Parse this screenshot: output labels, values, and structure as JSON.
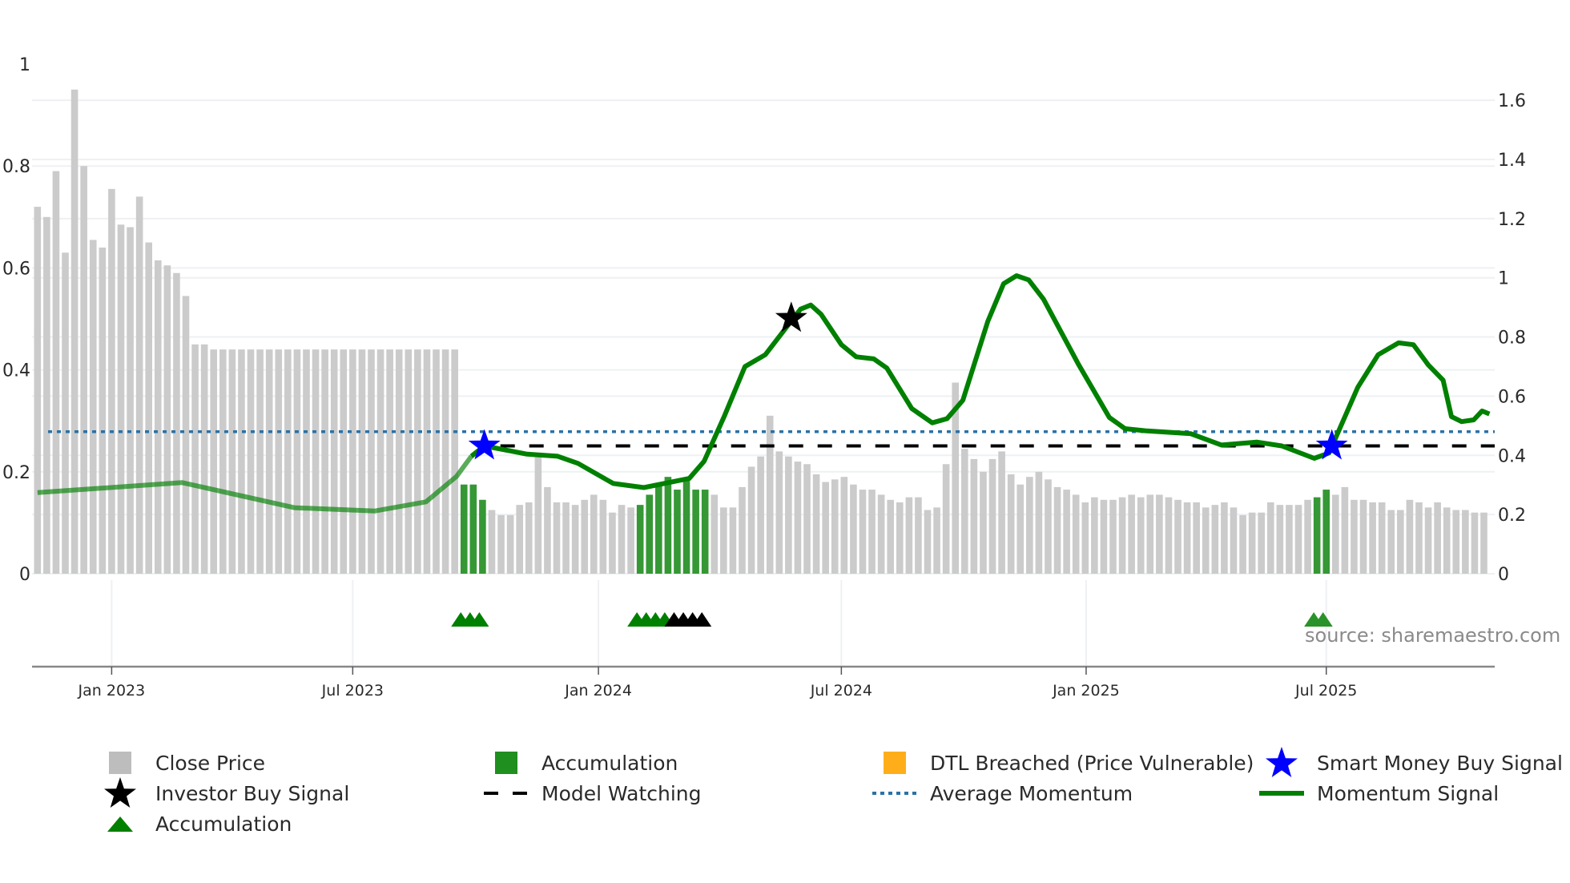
{
  "chart_data": {
    "type": "bar",
    "frequency": "weekly",
    "left_axis": {
      "ticks": [
        "0",
        "0.2",
        "0.4",
        "0.6",
        "0.8",
        "1"
      ],
      "values": [
        0,
        0.2,
        0.4,
        0.6,
        0.8,
        1.0
      ],
      "ylim": [
        0,
        1
      ]
    },
    "right_axis": {
      "ticks": [
        "0",
        "0.2",
        "0.4",
        "0.6",
        "0.8",
        "1",
        "1.2",
        "1.4",
        "1.6"
      ],
      "values": [
        0,
        0.2,
        0.4,
        0.6,
        0.8,
        1.0,
        1.2,
        1.4,
        1.6
      ],
      "ylim": [
        0,
        1.6
      ]
    },
    "x_ticks": [
      {
        "label": "Jan 2023",
        "week": 8
      },
      {
        "label": "Jul 2023",
        "week": 34
      },
      {
        "label": "Jan 2024",
        "week": 60.5
      },
      {
        "label": "Jul 2024",
        "week": 86.7
      },
      {
        "label": "Jan 2025",
        "week": 113.1
      },
      {
        "label": "Jul 2025",
        "week": 139
      }
    ],
    "close_price": [
      0.72,
      0.7,
      0.79,
      0.63,
      0.95,
      0.8,
      0.655,
      0.64,
      0.755,
      0.685,
      0.68,
      0.74,
      0.65,
      0.615,
      0.605,
      0.59,
      0.545,
      0.45,
      0.45,
      0.44,
      0.44,
      0.44,
      0.44,
      0.44,
      0.44,
      0.44,
      0.44,
      0.44,
      0.44,
      0.44,
      0.44,
      0.44,
      0.44,
      0.44,
      0.44,
      0.44,
      0.44,
      0.44,
      0.44,
      0.44,
      0.44,
      0.44,
      0.44,
      0.44,
      0.44,
      0.44,
      0.175,
      0.175,
      0.145,
      0.125,
      0.115,
      0.115,
      0.135,
      0.14,
      0.23,
      0.17,
      0.14,
      0.14,
      0.135,
      0.145,
      0.155,
      0.145,
      0.12,
      0.135,
      0.13,
      0.135,
      0.155,
      0.175,
      0.19,
      0.165,
      0.185,
      0.165,
      0.165,
      0.155,
      0.13,
      0.13,
      0.17,
      0.21,
      0.23,
      0.31,
      0.24,
      0.23,
      0.22,
      0.215,
      0.195,
      0.18,
      0.185,
      0.19,
      0.175,
      0.165,
      0.165,
      0.155,
      0.145,
      0.14,
      0.15,
      0.15,
      0.125,
      0.13,
      0.215,
      0.375,
      0.245,
      0.225,
      0.2,
      0.225,
      0.24,
      0.195,
      0.175,
      0.19,
      0.2,
      0.185,
      0.17,
      0.165,
      0.155,
      0.14,
      0.15,
      0.145,
      0.145,
      0.15,
      0.155,
      0.15,
      0.155,
      0.155,
      0.15,
      0.145,
      0.14,
      0.14,
      0.13,
      0.135,
      0.14,
      0.13,
      0.115,
      0.12,
      0.12,
      0.14,
      0.135,
      0.135,
      0.135,
      0.145,
      0.15,
      0.165,
      0.155,
      0.17,
      0.145,
      0.145,
      0.14,
      0.14,
      0.125,
      0.125,
      0.145,
      0.14,
      0.13,
      0.14,
      0.13,
      0.125,
      0.125,
      0.12,
      0.12
    ],
    "accumulation_weeks": [
      46,
      47,
      48,
      65,
      66,
      67,
      68,
      69,
      70,
      71,
      72,
      138,
      139
    ],
    "momentum_signal": [
      [
        0,
        0.274
      ],
      [
        15.6,
        0.308
      ],
      [
        27.7,
        0.223
      ],
      [
        36.4,
        0.212
      ],
      [
        41.9,
        0.243
      ],
      [
        45.2,
        0.329
      ],
      [
        46.8,
        0.397
      ],
      [
        48.2,
        0.432
      ],
      [
        52.8,
        0.404
      ],
      [
        56.1,
        0.397
      ],
      [
        58.3,
        0.373
      ],
      [
        62.1,
        0.305
      ],
      [
        65.4,
        0.291
      ],
      [
        70.3,
        0.322
      ],
      [
        71.9,
        0.38
      ],
      [
        74.1,
        0.534
      ],
      [
        76.3,
        0.7
      ],
      [
        78.5,
        0.74
      ],
      [
        81.2,
        0.85
      ],
      [
        82.3,
        0.894
      ],
      [
        83.4,
        0.908
      ],
      [
        84.5,
        0.877
      ],
      [
        86.7,
        0.774
      ],
      [
        88.3,
        0.733
      ],
      [
        90.2,
        0.726
      ],
      [
        91.6,
        0.695
      ],
      [
        94.3,
        0.558
      ],
      [
        96.5,
        0.51
      ],
      [
        98.1,
        0.524
      ],
      [
        99.8,
        0.586
      ],
      [
        102.5,
        0.853
      ],
      [
        104.2,
        0.98
      ],
      [
        105.6,
        1.007
      ],
      [
        106.9,
        0.993
      ],
      [
        108.5,
        0.928
      ],
      [
        112.3,
        0.706
      ],
      [
        115.6,
        0.528
      ],
      [
        117.3,
        0.49
      ],
      [
        119.5,
        0.483
      ],
      [
        124.4,
        0.473
      ],
      [
        127.7,
        0.435
      ],
      [
        131.5,
        0.445
      ],
      [
        134.2,
        0.432
      ],
      [
        137.7,
        0.39
      ],
      [
        139.3,
        0.408
      ],
      [
        142.4,
        0.63
      ],
      [
        144.6,
        0.74
      ],
      [
        146.8,
        0.78
      ],
      [
        148.4,
        0.774
      ],
      [
        150.0,
        0.706
      ],
      [
        151.6,
        0.654
      ],
      [
        152.5,
        0.531
      ],
      [
        153.6,
        0.514
      ],
      [
        154.9,
        0.52
      ],
      [
        155.8,
        0.55
      ],
      [
        156.6,
        0.54
      ]
    ],
    "momentum_faded_before_week": 46,
    "average_momentum": 0.48,
    "model_watching": {
      "value": 0.432,
      "from_week": 48.2
    },
    "smart_money_buy_signals": [
      [
        48.2,
        0.432
      ],
      [
        139.6,
        0.432
      ]
    ],
    "investor_buy_signals": [
      [
        81.3,
        0.863
      ]
    ],
    "accumulation_markers": [
      46,
      47,
      48,
      65,
      66,
      67,
      68,
      138,
      139
    ],
    "investor_markers": [
      69,
      70,
      71,
      72
    ],
    "annotation": "source: sharemaestro.com",
    "legend": [
      {
        "label": "Close Price",
        "symbol": "square",
        "color": "#bdbdbd"
      },
      {
        "label": "Accumulation",
        "symbol": "square",
        "color": "#1f8f1f"
      },
      {
        "label": "DTL Breached (Price Vulnerable)",
        "symbol": "square",
        "color": "#ffae1a"
      },
      {
        "label": "Smart Money Buy Signal",
        "symbol": "star",
        "color": "#0000ff"
      },
      {
        "label": "Investor Buy Signal",
        "symbol": "star",
        "color": "#000000"
      },
      {
        "label": "Model Watching",
        "symbol": "dash",
        "color": "#000000"
      },
      {
        "label": "Average Momentum",
        "symbol": "dot",
        "color": "#2a72a8"
      },
      {
        "label": "Momentum Signal",
        "symbol": "line",
        "color": "#008000"
      },
      {
        "label": "Accumulation",
        "symbol": "triangle",
        "color": "#008000"
      }
    ],
    "legend_placement": "bottom",
    "grid": true
  },
  "colors": {
    "gray_bar": "#c8c8c8",
    "green_bar": "#2a922a",
    "momentum": "#008000",
    "avg": "#2a72a8",
    "blue_star": "#0000ff"
  }
}
